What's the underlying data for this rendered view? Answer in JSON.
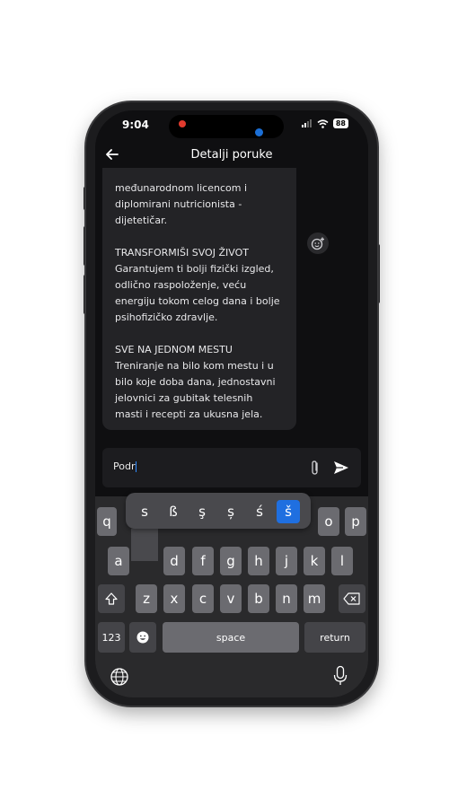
{
  "status_bar": {
    "time": "9:04",
    "battery": "88"
  },
  "header": {
    "title": "Detalji poruke"
  },
  "message": {
    "text": "međunarodnom licencom i\ndiplomirani nutricionista -\ndijetetičar.\n\nTRANSFORMIŠI SVOJ ŽIVOT\nGarantujem ti bolji fizički izgled,\nodlično raspoloženje, veću\nenergiju tokom celog dana i bolje\npsihofizičko zdravlje.\n\nSVE NA JEDNOM MESTU\nTreniranje na bilo kom mestu i u\nbilo koje doba dana, jednostavni\njelovnici za gubitak telesnih\nmasti i recepti za ukusna jela."
  },
  "composer": {
    "value": "Podr"
  },
  "keyboard": {
    "accent_popup": [
      "s",
      "ß",
      "ş",
      "ș",
      "ś",
      "š"
    ],
    "selected_accent": "š",
    "row1": [
      "q",
      "o",
      "p"
    ],
    "row2": [
      "a",
      "d",
      "f",
      "g",
      "h",
      "j",
      "k",
      "l"
    ],
    "row3": [
      "z",
      "x",
      "c",
      "v",
      "b",
      "n",
      "m"
    ],
    "numbers_label": "123",
    "space_label": "space",
    "return_label": "return"
  },
  "colors": {
    "accent": "#1f6fe0",
    "background": "#0f0f11",
    "bubble": "#232326"
  }
}
